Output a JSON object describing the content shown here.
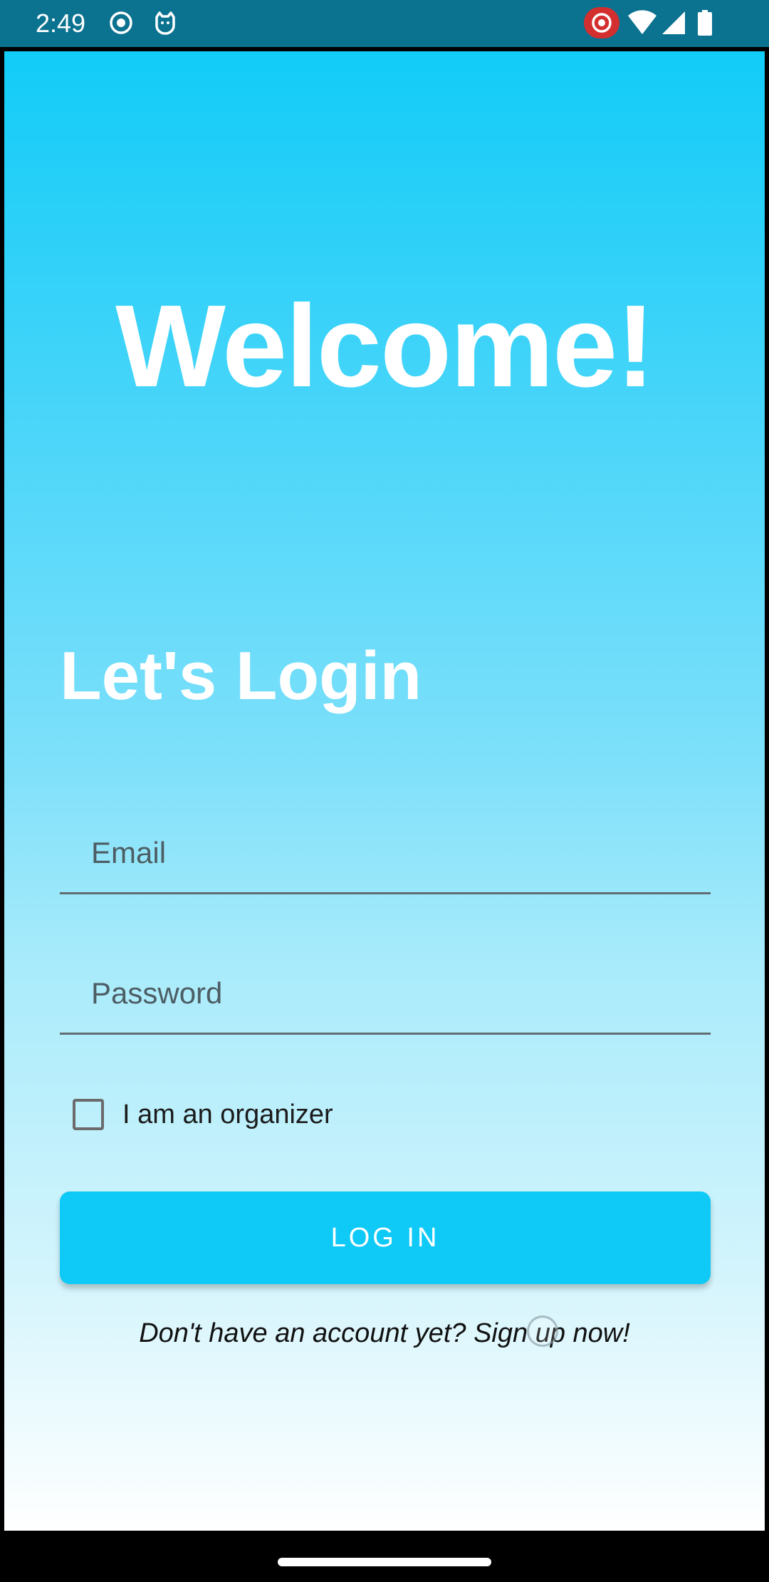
{
  "status_bar": {
    "time": "2:49",
    "icons": [
      "record-icon",
      "cat-icon",
      "screen-record-icon",
      "wifi-icon",
      "signal-icon",
      "battery-icon"
    ]
  },
  "welcome": "Welcome!",
  "login_title": "Let's Login",
  "email": {
    "placeholder": "Email",
    "value": ""
  },
  "password": {
    "placeholder": "Password",
    "value": ""
  },
  "organizer_checkbox": {
    "label": "I am an organizer",
    "checked": false
  },
  "login_button": "LOG IN",
  "signup_prompt": "Don't have an account yet? Sign up now!",
  "colors": {
    "status_bar": "#0b7290",
    "gradient_top": "#12ccf8",
    "gradient_bottom": "#ffffff",
    "button": "#0fcaf6"
  }
}
